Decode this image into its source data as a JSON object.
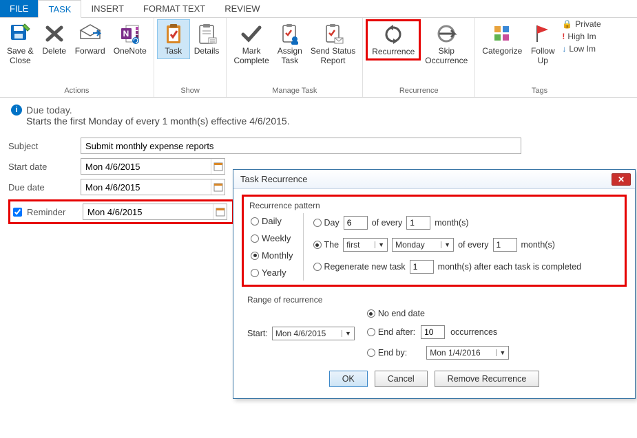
{
  "tabs": {
    "file": "FILE",
    "task": "TASK",
    "insert": "INSERT",
    "formatText": "FORMAT TEXT",
    "review": "REVIEW"
  },
  "ribbon": {
    "actions": {
      "label": "Actions",
      "saveClose": "Save &\nClose",
      "delete": "Delete",
      "forward": "Forward",
      "onenote": "OneNote"
    },
    "show": {
      "label": "Show",
      "task": "Task",
      "details": "Details"
    },
    "manage": {
      "label": "Manage Task",
      "markComplete": "Mark\nComplete",
      "assignTask": "Assign\nTask",
      "sendStatus": "Send Status\nReport"
    },
    "recur": {
      "label": "Recurrence",
      "recurrence": "Recurrence",
      "skip": "Skip\nOccurrence"
    },
    "tags": {
      "label": "Tags",
      "categorize": "Categorize",
      "followUp": "Follow\nUp",
      "private": "Private",
      "highImp": "High Im",
      "lowImp": "Low Im"
    }
  },
  "info": {
    "line1": "Due today.",
    "line2": "Starts the first Monday of every 1 month(s) effective 4/6/2015."
  },
  "form": {
    "subjectLabel": "Subject",
    "subject": "Submit monthly expense reports",
    "startLabel": "Start date",
    "start": "Mon 4/6/2015",
    "dueLabel": "Due date",
    "due": "Mon 4/6/2015",
    "reminderLabel": "Reminder",
    "reminder": "Mon 4/6/2015"
  },
  "dialog": {
    "title": "Task Recurrence",
    "patternTitle": "Recurrence pattern",
    "freq": {
      "daily": "Daily",
      "weekly": "Weekly",
      "monthly": "Monthly",
      "yearly": "Yearly"
    },
    "opt1": {
      "day": "Day",
      "dayNum": "6",
      "ofEvery": "of every",
      "monthNum": "1",
      "months": "month(s)"
    },
    "opt2": {
      "the": "The",
      "ord": "first",
      "dow": "Monday",
      "ofEvery": "of every",
      "monthNum": "1",
      "months": "month(s)"
    },
    "opt3": {
      "regen": "Regenerate new task",
      "num": "1",
      "after": "month(s) after each task is completed"
    },
    "rangeTitle": "Range of recurrence",
    "startLabel": "Start:",
    "startVal": "Mon 4/6/2015",
    "noEnd": "No end date",
    "endAfter": "End after:",
    "occNum": "10",
    "occ": "occurrences",
    "endBy": "End by:",
    "endByVal": "Mon 1/4/2016",
    "ok": "OK",
    "cancel": "Cancel",
    "remove": "Remove Recurrence"
  }
}
